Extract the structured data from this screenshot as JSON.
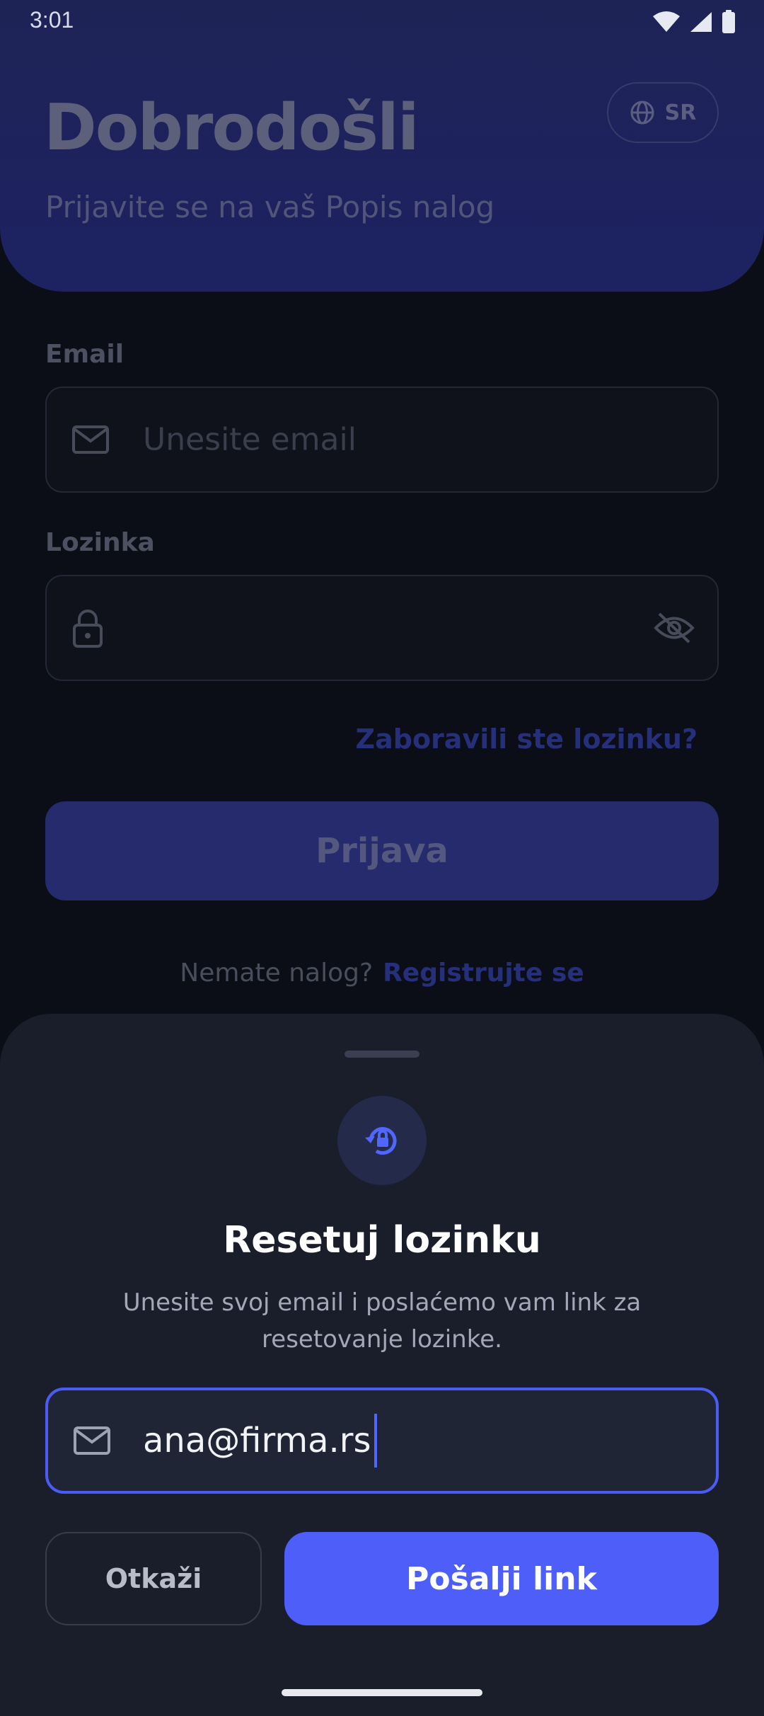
{
  "status_bar": {
    "time": "3:01"
  },
  "header": {
    "title": "Dobrodošli",
    "subtitle": "Prijavite se na vaš Popis nalog",
    "language": "SR"
  },
  "form": {
    "email_label": "Email",
    "email_placeholder": "Unesite email",
    "password_label": "Lozinka",
    "forgot_link": "Zaboravili ste lozinku?",
    "login_button": "Prijava",
    "no_account_text": "Nemate nalog?",
    "register_link": "Registrujte se"
  },
  "reset_sheet": {
    "title": "Resetuj lozinku",
    "description": "Unesite svoj email i poslaćemo vam link za resetovanje lozinke.",
    "email_value": "ana@firma.rs",
    "cancel_button": "Otkaži",
    "send_button": "Pošalji link"
  },
  "colors": {
    "accent": "#4d5ef9",
    "sheet_background": "#1a1e2a",
    "header_background": "#1e2356"
  }
}
